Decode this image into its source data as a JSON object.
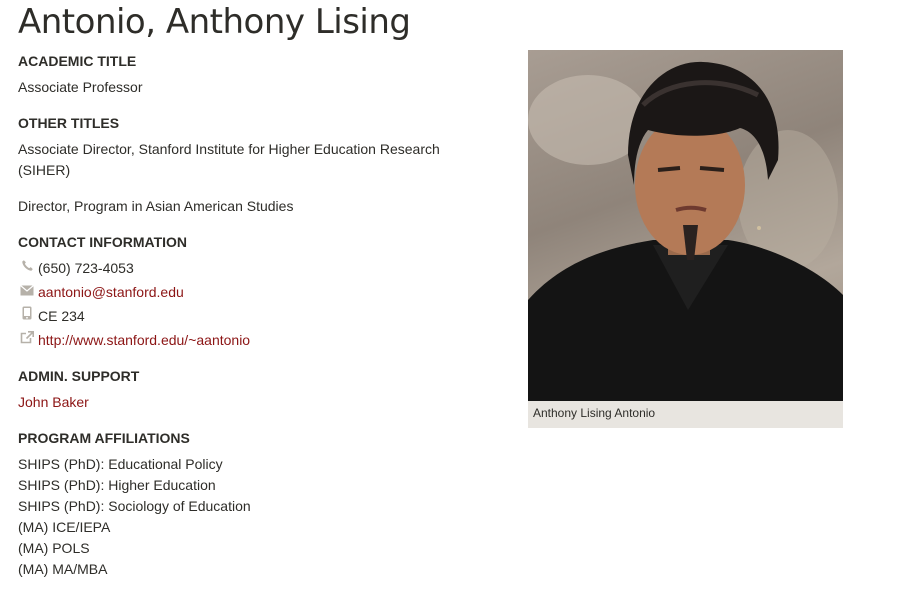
{
  "page": {
    "title": "Antonio, Anthony Lising"
  },
  "academic_title": {
    "heading": "ACADEMIC TITLE",
    "value": "Associate Professor"
  },
  "other_titles": {
    "heading": "OTHER TITLES",
    "items": [
      {
        "line1": "Associate Director, Stanford Institute for Higher Education Research",
        "line2": "(SIHER)"
      },
      {
        "line1": "Director, Program in Asian American Studies"
      }
    ]
  },
  "contact": {
    "heading": "CONTACT INFORMATION",
    "phone": {
      "icon": "phone-icon",
      "value": "(650) 723-4053"
    },
    "email": {
      "icon": "envelope-icon",
      "value": "aantonio@stanford.edu"
    },
    "office": {
      "icon": "mobile-icon",
      "value": "CE 234"
    },
    "website": {
      "icon": "external-link-icon",
      "value": "http://www.stanford.edu/~aantonio"
    }
  },
  "admin_support": {
    "heading": "ADMIN. SUPPORT",
    "name": "John Baker"
  },
  "program_affiliations": {
    "heading": "PROGRAM AFFILIATIONS",
    "items": [
      "SHIPS (PhD): Educational Policy",
      "SHIPS (PhD): Higher Education",
      "SHIPS (PhD): Sociology of Education",
      "(MA) ICE/IEPA",
      "(MA) POLS",
      "(MA) MA/MBA"
    ]
  },
  "photo": {
    "caption": "Anthony Lising Antonio"
  },
  "colors": {
    "text": "#2e2d29",
    "link": "#8c1515",
    "icon": "#b6b1a9",
    "caption_bg": "#e8e5e0"
  }
}
